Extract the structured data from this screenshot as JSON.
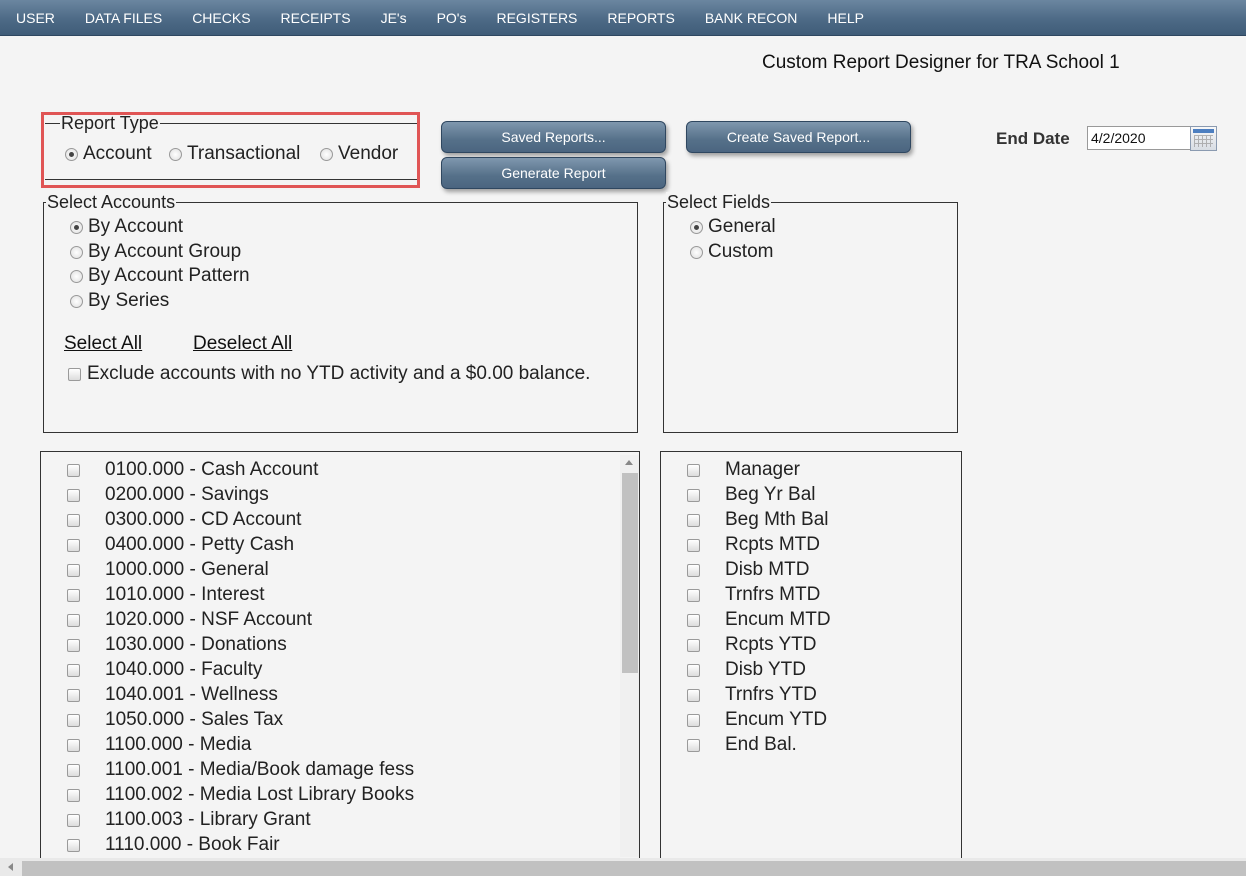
{
  "menu": [
    "USER",
    "DATA FILES",
    "CHECKS",
    "RECEIPTS",
    "JE's",
    "PO's",
    "REGISTERS",
    "REPORTS",
    "BANK RECON",
    "HELP"
  ],
  "page_title": "Custom Report Designer for TRA School 1",
  "report_type": {
    "legend": "Report Type",
    "options": [
      "Account",
      "Transactional",
      "Vendor"
    ],
    "selected": "Account"
  },
  "buttons": {
    "saved_reports": "Saved Reports...",
    "generate_report": "Generate Report",
    "create_saved_report": "Create Saved Report..."
  },
  "end_date": {
    "label": "End Date",
    "value": "4/2/2020"
  },
  "select_accounts": {
    "legend": "Select Accounts",
    "options": [
      "By Account",
      "By Account Group",
      "By Account Pattern",
      "By Series"
    ],
    "selected": "By Account",
    "select_all": "Select All",
    "deselect_all": "Deselect All",
    "exclude_label": "Exclude accounts with no YTD activity and a $0.00 balance."
  },
  "select_fields": {
    "legend": "Select Fields",
    "options": [
      "General",
      "Custom"
    ],
    "selected": "General"
  },
  "accounts": [
    "0100.000 - Cash Account",
    "0200.000 - Savings",
    "0300.000 - CD Account",
    "0400.000 - Petty Cash",
    "1000.000 - General",
    "1010.000 - Interest",
    "1020.000 - NSF Account",
    "1030.000 - Donations",
    "1040.000 - Faculty",
    "1040.001 - Wellness",
    "1050.000 - Sales Tax",
    "1100.000 - Media",
    "1100.001 - Media/Book damage fess",
    "1100.002 - Media Lost Library Books",
    "1100.003 - Library Grant",
    "1110.000 - Book Fair"
  ],
  "fields": [
    "Manager",
    "Beg Yr Bal",
    "Beg Mth Bal",
    "Rcpts MTD",
    "Disb MTD",
    "Trnfrs MTD",
    "Encum MTD",
    "Rcpts YTD",
    "Disb YTD",
    "Trnfrs YTD",
    "Encum YTD",
    "End Bal."
  ]
}
